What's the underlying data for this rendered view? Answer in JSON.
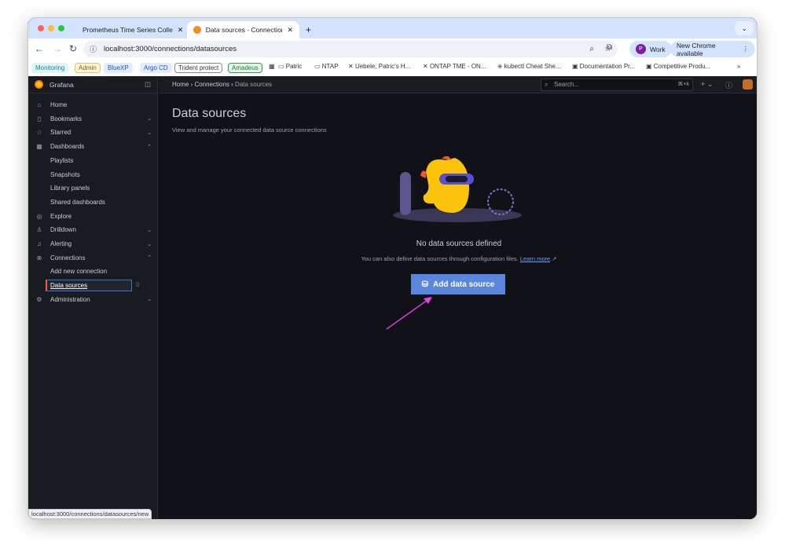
{
  "browser": {
    "tabs": [
      {
        "title": "Prometheus Time Series Colle",
        "active": false
      },
      {
        "title": "Data sources - Connections -",
        "active": true
      }
    ],
    "url": "localhost:3000/connections/datasources",
    "profile": "Work",
    "profile_initial": "P",
    "update": "New Chrome available",
    "bookmarks": [
      {
        "label": "Monitoring",
        "color": "#1a8a8a",
        "bg": "#dff4f4"
      },
      {
        "label": "Admin",
        "color": "#8a5a00",
        "bg": "#fff6dd",
        "border": "#f0c060"
      },
      {
        "label": "BlueXP",
        "color": "#1a55cc",
        "bg": "#e3ecfd"
      },
      {
        "label": "Argo CD",
        "color": "#1a55cc",
        "bg": "#e3ecfd"
      },
      {
        "label": "Trident protect",
        "color": "#333",
        "bg": "#fff",
        "border": "#888"
      },
      {
        "label": "Amadeus",
        "color": "#1f7a3a",
        "bg": "#e6f5ea",
        "border": "#3a9a55"
      }
    ],
    "bookmark_links": [
      "Patric",
      "NTAP",
      "Uebele, Patric's H...",
      "ONTAP TME - ON...",
      "kubectl Cheat She...",
      "Documentation Pr...",
      "Competitive Produ..."
    ],
    "status_url": "localhost:3000/connections/datasources/new"
  },
  "grafana": {
    "brand": "Grafana",
    "breadcrumb": [
      "Home",
      "Connections",
      "Data sources"
    ],
    "search_placeholder": "Search...",
    "search_shortcut": "⌘+k",
    "nav": [
      {
        "label": "Home",
        "icon": "⌂"
      },
      {
        "label": "Bookmarks",
        "icon": "▯",
        "chev": "⌄"
      },
      {
        "label": "Starred",
        "icon": "☆",
        "chev": "⌄"
      },
      {
        "label": "Dashboards",
        "icon": "▦",
        "chev": "⌃"
      },
      {
        "label": "Playlists",
        "sub": true
      },
      {
        "label": "Snapshots",
        "sub": true
      },
      {
        "label": "Library panels",
        "sub": true
      },
      {
        "label": "Shared dashboards",
        "sub": true
      },
      {
        "label": "Explore",
        "icon": "◎"
      },
      {
        "label": "Drilldown",
        "icon": "♙",
        "chev": "⌄"
      },
      {
        "label": "Alerting",
        "icon": "♫",
        "chev": "⌄"
      },
      {
        "label": "Connections",
        "icon": "⊗",
        "chev": "⌃"
      },
      {
        "label": "Add new connection",
        "sub": true
      },
      {
        "label": "Data sources",
        "sub": true,
        "selected": true
      },
      {
        "label": "Administration",
        "icon": "⚙",
        "chev": "⌄"
      }
    ],
    "page_title": "Data sources",
    "page_subtitle": "View and manage your connected data source connections",
    "empty_title": "No data sources defined",
    "empty_hint": "You can also define data sources through configuration files.",
    "learn_more": "Learn more",
    "add_button": "Add data source"
  }
}
